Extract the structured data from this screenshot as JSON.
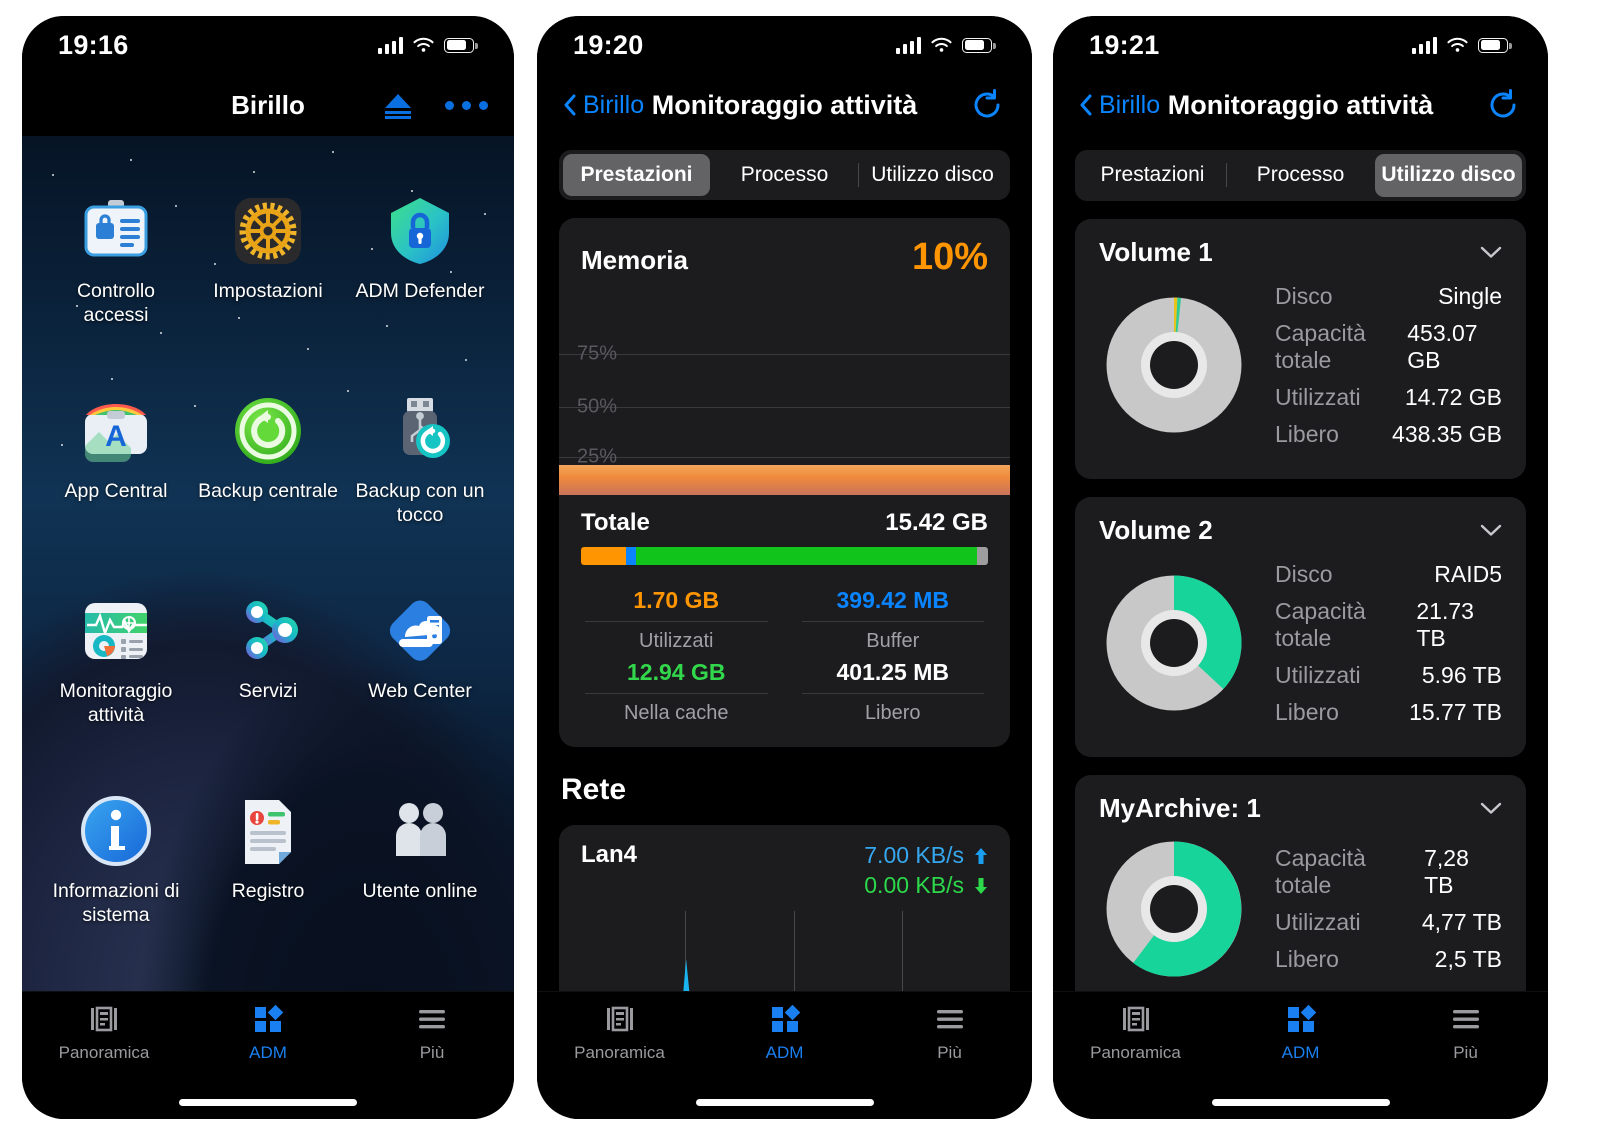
{
  "phone1": {
    "status": {
      "time": "19:16",
      "cellular_icon": "cellular-signal-icon",
      "wifi_icon": "wifi-icon",
      "battery_icon": "battery-icon"
    },
    "nav": {
      "title": "Birillo",
      "eject_icon": "eject-icon",
      "more_icon": "more-options-icon"
    },
    "apps": [
      {
        "label": "Controllo accessi",
        "icon": "access-control-icon"
      },
      {
        "label": "Impostazioni",
        "icon": "settings-gear-icon"
      },
      {
        "label": "ADM Defender",
        "icon": "shield-lock-icon"
      },
      {
        "label": "App Central",
        "icon": "app-central-icon"
      },
      {
        "label": "Backup centrale",
        "icon": "central-backup-icon"
      },
      {
        "label": "Backup con un tocco",
        "icon": "one-touch-backup-icon"
      },
      {
        "label": "Monitoraggio attività",
        "icon": "activity-monitor-icon"
      },
      {
        "label": "Servizi",
        "icon": "services-icon"
      },
      {
        "label": "Web Center",
        "icon": "web-center-icon"
      },
      {
        "label": "Informazioni di sistema",
        "icon": "system-info-icon"
      },
      {
        "label": "Registro",
        "icon": "log-document-icon"
      },
      {
        "label": "Utente online",
        "icon": "online-users-icon"
      }
    ],
    "tabbar": [
      {
        "label": "Panoramica",
        "icon": "overview-icon",
        "active": false
      },
      {
        "label": "ADM",
        "icon": "adm-squares-icon",
        "active": true
      },
      {
        "label": "Più",
        "icon": "hamburger-more-icon",
        "active": false
      }
    ]
  },
  "phone2": {
    "status": {
      "time": "19:20"
    },
    "nav": {
      "back_label": "Birillo",
      "title": "Monitoraggio attività",
      "refresh_icon": "refresh-icon"
    },
    "tabs": [
      {
        "label": "Prestazioni",
        "active": true
      },
      {
        "label": "Processo",
        "active": false
      },
      {
        "label": "Utilizzo disco",
        "active": false
      }
    ],
    "memory": {
      "title": "Memoria",
      "percent": "10%",
      "gridlines": [
        "75%",
        "50%",
        "25%"
      ],
      "total_label": "Totale",
      "total_value": "15.42 GB",
      "stats": [
        {
          "value": "1.70 GB",
          "label": "Utilizzati",
          "color": "#ff9500"
        },
        {
          "value": "399.42 MB",
          "label": "Buffer",
          "color": "#0a84ff"
        },
        {
          "value": "12.94 GB",
          "label": "Nella cache",
          "color": "#32d74b"
        },
        {
          "value": "401.25 MB",
          "label": "Libero",
          "color": "#ffffff"
        }
      ]
    },
    "network": {
      "section_title": "Rete",
      "name": "Lan4",
      "upload": "7.00 KB/s",
      "download": "0.00 KB/s"
    },
    "tabbar": [
      {
        "label": "Panoramica",
        "active": false
      },
      {
        "label": "ADM",
        "active": true
      },
      {
        "label": "Più",
        "active": false
      }
    ]
  },
  "phone3": {
    "status": {
      "time": "19:21"
    },
    "nav": {
      "back_label": "Birillo",
      "title": "Monitoraggio attività",
      "refresh_icon": "refresh-icon"
    },
    "tabs": [
      {
        "label": "Prestazioni",
        "active": false
      },
      {
        "label": "Processo",
        "active": false
      },
      {
        "label": "Utilizzo disco",
        "active": true
      }
    ],
    "volumes": [
      {
        "name": "Volume 1",
        "rows": [
          {
            "key": "Disco",
            "value": "Single"
          },
          {
            "key": "Capacità totale",
            "value": "453.07 GB"
          },
          {
            "key": "Utilizzati",
            "value": "14.72 GB"
          },
          {
            "key": "Libero",
            "value": "438.35 GB"
          }
        ]
      },
      {
        "name": "Volume 2",
        "rows": [
          {
            "key": "Disco",
            "value": "RAID5"
          },
          {
            "key": "Capacità totale",
            "value": "21.73 TB"
          },
          {
            "key": "Utilizzati",
            "value": "5.96 TB"
          },
          {
            "key": "Libero",
            "value": "15.77 TB"
          }
        ]
      },
      {
        "name": "MyArchive: 1",
        "rows": [
          {
            "key": "Capacità totale",
            "value": "7,28 TB"
          },
          {
            "key": "Utilizzati",
            "value": "4,77 TB"
          },
          {
            "key": "Libero",
            "value": "2,5 TB"
          }
        ]
      }
    ],
    "tabbar": [
      {
        "label": "Panoramica",
        "active": false
      },
      {
        "label": "ADM",
        "active": true
      },
      {
        "label": "Più",
        "active": false
      }
    ]
  },
  "chart_data": [
    {
      "type": "area",
      "title": "Memoria",
      "ylabel": "%",
      "ylim": [
        0,
        100
      ],
      "yticks": [
        25,
        50,
        75
      ],
      "grid": true,
      "legend": "none",
      "annotation": "10%",
      "series": [
        {
          "name": "Memoria utilizzata",
          "values": [
            10,
            10,
            10,
            10,
            10,
            10,
            10,
            10,
            10,
            10
          ],
          "color": "#f09040"
        }
      ]
    },
    {
      "type": "bar",
      "title": "Totale 15.42 GB",
      "orientation": "stacked-horizontal",
      "categories": [
        "Utilizzati",
        "Buffer",
        "Nella cache",
        "Libero"
      ],
      "values": [
        1.7,
        0.39,
        12.94,
        0.39
      ],
      "value_labels": [
        "1.70 GB",
        "399.42 MB",
        "12.94 GB",
        "401.25 MB"
      ],
      "colors": [
        "#ff9500",
        "#0a84ff",
        "#11c41c",
        "#9e9e9e"
      ],
      "total": 15.42,
      "unit": "GB"
    },
    {
      "type": "area",
      "title": "Lan4",
      "series": [
        {
          "name": "Upload",
          "color": "#1ab4f0",
          "peak": "7.00 KB/s"
        },
        {
          "name": "Download",
          "color": "#31d158",
          "peak": "0.00 KB/s"
        }
      ],
      "grid": true,
      "gridlines_vertical": 3
    },
    {
      "type": "pie",
      "title": "Volume 1",
      "labels": [
        "Utilizzati-a",
        "Utilizzati-b",
        "Libero"
      ],
      "values": [
        1.6,
        1.7,
        96.7
      ],
      "colors": [
        "#e8c41b",
        "#2ecc8f",
        "#c8c8c8"
      ],
      "unit": "%"
    },
    {
      "type": "pie",
      "title": "Volume 2",
      "labels": [
        "Utilizzati",
        "Libero"
      ],
      "values": [
        27.4,
        72.6
      ],
      "colors": [
        "#16d49a",
        "#c8c8c8"
      ],
      "unit": "%"
    },
    {
      "type": "pie",
      "title": "MyArchive: 1",
      "labels": [
        "Utilizzati",
        "Libero"
      ],
      "values": [
        65.5,
        34.5
      ],
      "colors": [
        "#16d49a",
        "#c8c8c8"
      ],
      "unit": "%"
    }
  ]
}
